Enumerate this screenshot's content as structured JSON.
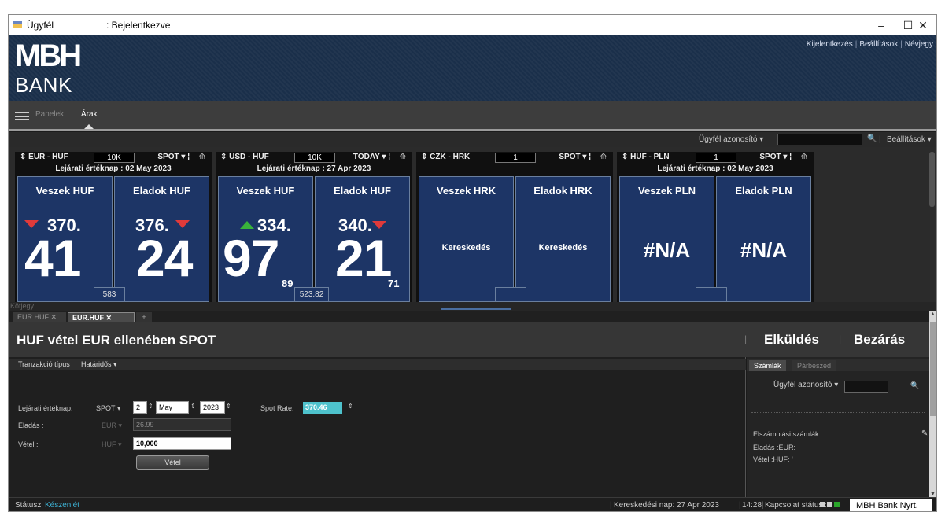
{
  "titlebar": {
    "app_name": "Ügyfél",
    "login_status": ": Bejelentkezve",
    "minimize": "–",
    "maximize": "☐",
    "close": "✕"
  },
  "brand": {
    "logo_top": "MBH",
    "logo_bottom": "BANK",
    "links": [
      "Kijelentkezés",
      "Beállítások",
      "Névjegy"
    ],
    "link_sep": "|"
  },
  "menu": {
    "tabs": [
      "Panelek",
      "Árak"
    ],
    "active": "Árak"
  },
  "toolbar": {
    "client_id_label": "Ügyfél azonosító ▾",
    "search": "🔍",
    "sep": "|",
    "settings": "Beállítások ▾"
  },
  "tiles": [
    {
      "pair_prefix": "⇕ EUR - ",
      "pair_ccy": "HUF",
      "amount": "10K",
      "mode": "SPOT ▾ ¦",
      "pin": "⟰",
      "value_date": "Lejárati értéknap : 02 May 2023",
      "buy_label": "Veszek HUF",
      "sell_label": "Eladok HUF",
      "buy_small": "370.",
      "buy_large": "41",
      "buy_pips": "",
      "sell_small": "376.",
      "sell_large": "24",
      "sell_pips": "",
      "buy_arrow": "down",
      "sell_arrow": "down",
      "spread": "583"
    },
    {
      "pair_prefix": "⇕ USD - ",
      "pair_ccy": "HUF",
      "amount": "10K",
      "mode": "TODAY ▾ ¦",
      "pin": "⟰",
      "value_date": "Lejárati értéknap : 27 Apr 2023",
      "buy_label": "Veszek HUF",
      "sell_label": "Eladok HUF",
      "buy_small": "334.",
      "buy_large": "97",
      "buy_pips": "89",
      "sell_small": "340.",
      "sell_large": "21",
      "sell_pips": "71",
      "buy_arrow": "up",
      "sell_arrow": "down",
      "spread": "523.82"
    },
    {
      "pair_prefix": "⇕ CZK - ",
      "pair_ccy": "HRK",
      "amount": "1",
      "mode": "SPOT ▾ ¦",
      "pin": "⟰",
      "value_date": "",
      "buy_label": "Veszek HRK",
      "sell_label": "Eladok HRK",
      "buy_text": "Kereskedés",
      "sell_text": "Kereskedés",
      "spread": ""
    },
    {
      "pair_prefix": "⇕ HUF - ",
      "pair_ccy": "PLN",
      "amount": "1",
      "mode": "SPOT ▾ ¦",
      "pin": "⟰",
      "value_date": "Lejárati értéknap : 02 May 2023",
      "buy_label": "Veszek PLN",
      "sell_label": "Eladok PLN",
      "buy_na": "#N/A",
      "sell_na": "#N/A",
      "spread": ""
    }
  ],
  "divider_label": "Kötjegy",
  "ticket": {
    "tabs": [
      "EUR.HUF ✕",
      "EUR.HUF ✕",
      "+"
    ],
    "title": "HUF vétel EUR ellenében SPOT",
    "actions": [
      "Elküldés",
      "Bezárás"
    ],
    "action_sep": "|",
    "transaction_type_label": "Tranzakció típus",
    "transaction_type_value": "Határidős ▾",
    "value_date_label": "Lejárati értéknap:",
    "tenor": "SPOT ▾",
    "day": "2",
    "month": "May",
    "year": "2023",
    "spot_rate_label": "Spot Rate:",
    "spot_rate_value": "370.46",
    "sell_label": "Eladás :",
    "sell_ccy": "EUR ▾",
    "sell_amount": "26.99",
    "buy_label": "Vétel :",
    "buy_ccy": "HUF ▾",
    "buy_amount": "10,000",
    "submit": "Vétel"
  },
  "right_panel": {
    "tabs": [
      "Számlák",
      "Párbeszéd"
    ],
    "client_id_label": "Ügyfél azonosító ▾",
    "settlement_title": "Elszámolási számlák",
    "sell_account": "Eladás :EUR:",
    "buy_account": "Vétel :HUF: '"
  },
  "status": {
    "label": "Státusz",
    "value": "Készenlét",
    "trading_day": "Kereskedési nap: 27 Apr 2023",
    "time": "14:28",
    "connection": "Kapcsolat státusza",
    "company": "MBH Bank Nyrt."
  },
  "colors": {
    "tile_blue": "#1d3566",
    "arrow_up": "#39b33b",
    "arrow_down": "#e03a3a",
    "spot_rate": "#4ec2cc",
    "ready": "#3db3d6",
    "brand_bg": "#1a2f4a"
  }
}
